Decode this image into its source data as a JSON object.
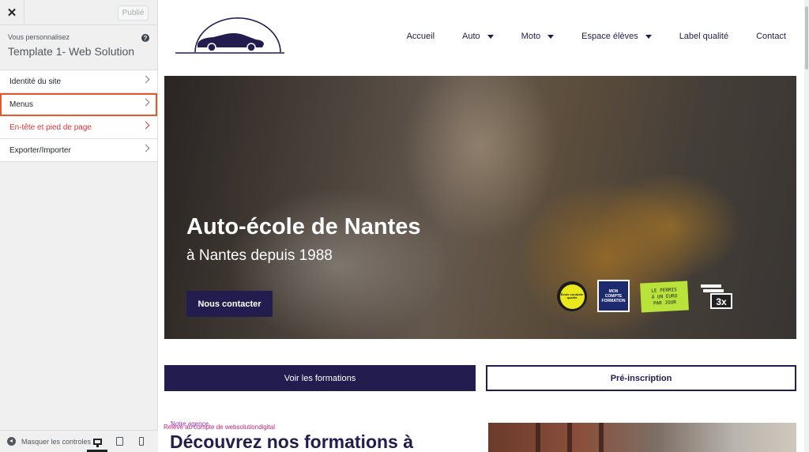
{
  "customizer": {
    "publish_label": "Publié",
    "intro_small": "Vous personnalisez",
    "intro_title": "Template 1- Web Solution",
    "menu": [
      {
        "label": "Identité du site"
      },
      {
        "label": "Menus"
      },
      {
        "label": "En-tête et pied de page"
      },
      {
        "label": "Exporter/Importer"
      }
    ],
    "footer": {
      "collapse_label": "Masquer les controles"
    }
  },
  "site": {
    "nav": [
      {
        "label": "Accueil"
      },
      {
        "label": "Auto"
      },
      {
        "label": "Moto"
      },
      {
        "label": "Espace élèves"
      },
      {
        "label": "Label qualité"
      },
      {
        "label": "Contact"
      }
    ],
    "hero": {
      "title": "Auto-école de Nantes",
      "subtitle": "à Nantes depuis 1988",
      "cta": "Nous contacter",
      "badges": {
        "qualite": "École conduite qualité",
        "cpf_line1": "MON",
        "cpf_line2": "COMPTE",
        "cpf_line3": "FORMATION",
        "euro_line1": "LE PERMIS",
        "euro_line2": "À UN EURO",
        "euro_line3": "PAR JOUR",
        "installments": "3x"
      }
    },
    "buttons": {
      "formations": "Voir les formations",
      "preinscription": "Pré-inscription"
    },
    "section": {
      "overlay_a": "Notre agence",
      "overlay_b": "Relevé au compte de websolutiondigital",
      "title": "Découvrez nos formations à"
    }
  },
  "colors": {
    "brand_navy": "#221c4f",
    "highlight": "#e05a2b",
    "alert_red": "#d63638"
  }
}
